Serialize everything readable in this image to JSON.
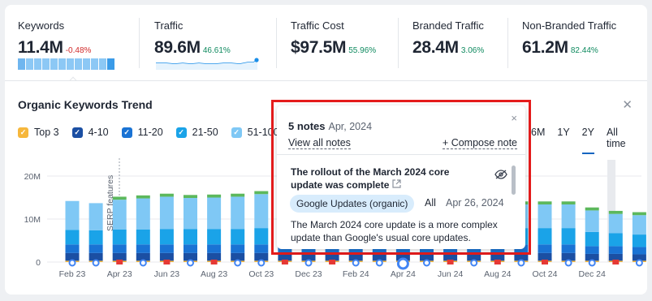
{
  "metrics": [
    {
      "label": "Keywords",
      "value": "11.4M",
      "delta": "-0.48%",
      "delta_color": "#d12b2b",
      "spark": "bars"
    },
    {
      "label": "Traffic",
      "value": "89.6M",
      "delta": "46.61%",
      "delta_color": "#0f8a5f",
      "spark": "line"
    },
    {
      "label": "Traffic Cost",
      "value": "$97.5M",
      "delta": "55.96%",
      "delta_color": "#0f8a5f"
    },
    {
      "label": "Branded Traffic",
      "value": "28.4M",
      "delta": "3.06%",
      "delta_color": "#0f8a5f"
    },
    {
      "label": "Non-Branded Traffic",
      "value": "61.2M",
      "delta": "82.44%",
      "delta_color": "#0f8a5f"
    }
  ],
  "trend": {
    "title": "Organic Keywords Trend",
    "legend": [
      {
        "label": "Top 3",
        "color": "#f6b73c"
      },
      {
        "label": "4-10",
        "color": "#1b4fa3"
      },
      {
        "label": "11-20",
        "color": "#1a73d4"
      },
      {
        "label": "21-50",
        "color": "#1aa3e8"
      },
      {
        "label": "51-100",
        "color": "#7fc8f5"
      },
      {
        "label": "SERP features",
        "color": "#5cb85c"
      }
    ],
    "ranges": [
      "6M",
      "1Y",
      "2Y",
      "All time"
    ],
    "active_range": "2Y"
  },
  "chart_data": {
    "type": "bar",
    "stacked": true,
    "y_ticks": [
      "0",
      "10M",
      "20M"
    ],
    "ylim": [
      0,
      20000000
    ],
    "x_ticks": [
      "Feb 23",
      "Apr 23",
      "Jun 23",
      "Aug 23",
      "Oct 23",
      "Dec 23",
      "Feb 24",
      "Apr 24",
      "Jun 24",
      "Aug 24",
      "Oct 24",
      "Dec 24"
    ],
    "annotation": "SERP features",
    "series": [
      {
        "name": "Top 3",
        "color": "#f6b73c",
        "values": [
          0.3,
          0.3,
          0.3,
          0.3,
          0.3,
          0.3,
          0.3,
          0.3,
          0.3,
          0.3,
          0.3,
          0.3,
          0.3,
          0.3,
          0.3,
          0.3,
          0.3,
          0.3,
          0.3,
          0.3,
          0.3,
          0.3,
          0.3,
          0.3,
          0.3,
          0.3,
          0.3
        ]
      },
      {
        "name": "4-10",
        "color": "#1b4fa3",
        "values": [
          1.8,
          1.8,
          1.8,
          1.8,
          1.8,
          1.8,
          1.8,
          1.8,
          1.8,
          1.8,
          1.8,
          1.8,
          1.8,
          1.8,
          1.8,
          1.8,
          1.8,
          1.8,
          1.8,
          1.8,
          1.8,
          1.8,
          1.6,
          1.6,
          1.5,
          1.5,
          1.5
        ]
      },
      {
        "name": "11-20",
        "color": "#1a73d4",
        "values": [
          2.0,
          2.0,
          2.0,
          2.0,
          2.0,
          2.0,
          2.0,
          2.0,
          2.0,
          2.0,
          2.0,
          2.0,
          2.0,
          2.0,
          2.0,
          2.0,
          2.0,
          2.0,
          2.0,
          2.0,
          2.0,
          2.0,
          1.8,
          1.8,
          1.7,
          1.7,
          1.7
        ]
      },
      {
        "name": "21-50",
        "color": "#1aa3e8",
        "values": [
          3.4,
          3.3,
          3.5,
          3.5,
          3.6,
          3.6,
          3.6,
          3.6,
          3.8,
          3.8,
          3.8,
          3.8,
          3.8,
          3.8,
          3.8,
          3.8,
          3.8,
          3.8,
          3.8,
          3.8,
          3.8,
          3.8,
          3.3,
          3.0,
          2.9,
          3.0,
          3.0
        ]
      },
      {
        "name": "51-100",
        "color": "#7fc8f5",
        "values": [
          6.7,
          6.3,
          6.9,
          7.2,
          7.5,
          7.2,
          7.3,
          7.5,
          7.9,
          5.5,
          5.5,
          5.5,
          5.5,
          5.5,
          5.5,
          5.5,
          5.5,
          5.5,
          5.5,
          5.5,
          5.5,
          5.5,
          5.0,
          4.5,
          4.5,
          4.6,
          4.6
        ]
      },
      {
        "name": "SERP features",
        "color": "#5cb85c",
        "values": [
          0,
          0,
          0.7,
          0.7,
          0.7,
          0.7,
          0.7,
          0.7,
          0.7,
          0.7,
          0.7,
          0.7,
          0.7,
          0.7,
          0.7,
          0.7,
          0.7,
          0.7,
          0.7,
          0.7,
          0.7,
          0.7,
          0.7,
          0.7,
          0.7,
          0.7,
          0.7
        ]
      }
    ]
  },
  "notes_popup": {
    "count": "5 notes",
    "date": "Apr, 2024",
    "view_all": "View all notes",
    "compose": "+ Compose note",
    "close": "×",
    "note": {
      "title": "The rollout of the March 2024 core update was complete",
      "tag": "Google Updates (organic)",
      "scope": "All",
      "date": "Apr 26, 2024",
      "body": "The March 2024 core update is a more complex update than Google's usual core updates."
    }
  }
}
